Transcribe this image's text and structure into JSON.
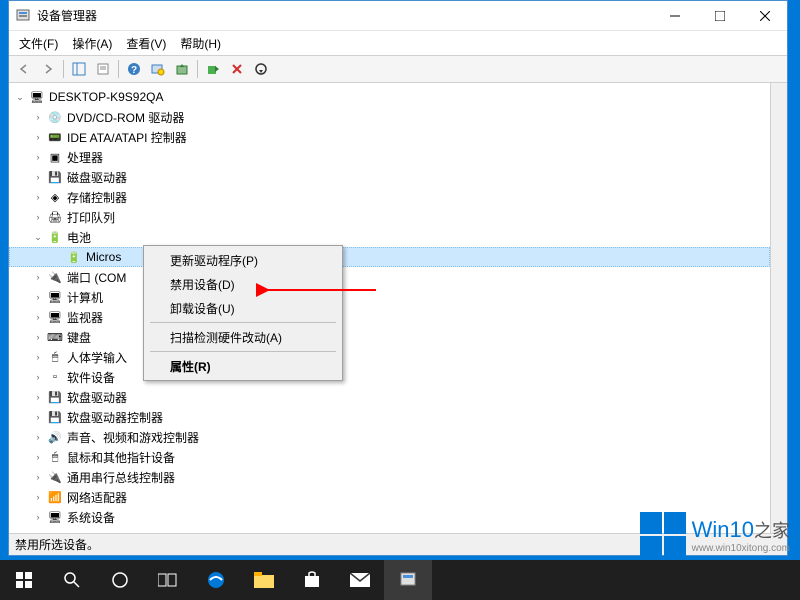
{
  "window": {
    "title": "设备管理器"
  },
  "menubar": {
    "file": "文件(F)",
    "action": "操作(A)",
    "view": "查看(V)",
    "help": "帮助(H)"
  },
  "tree": {
    "root": "DESKTOP-K9S92QA",
    "items": [
      {
        "label": "DVD/CD-ROM 驱动器",
        "icon": "💿"
      },
      {
        "label": "IDE ATA/ATAPI 控制器",
        "icon": "📟"
      },
      {
        "label": "处理器",
        "icon": "▣"
      },
      {
        "label": "磁盘驱动器",
        "icon": "💾"
      },
      {
        "label": "存储控制器",
        "icon": "◈"
      },
      {
        "label": "打印队列",
        "icon": "🖨"
      },
      {
        "label": "电池",
        "icon": "🔋",
        "expanded": true,
        "children": [
          {
            "label": "Micros",
            "icon": "🔋",
            "selected": true
          }
        ]
      },
      {
        "label": "端口 (COM",
        "icon": "🔌"
      },
      {
        "label": "计算机",
        "icon": "🖥"
      },
      {
        "label": "监视器",
        "icon": "🖥"
      },
      {
        "label": "键盘",
        "icon": "⌨"
      },
      {
        "label": "人体学输入",
        "icon": "🖱"
      },
      {
        "label": "软件设备",
        "icon": "▫"
      },
      {
        "label": "软盘驱动器",
        "icon": "💾"
      },
      {
        "label": "软盘驱动器控制器",
        "icon": "💾"
      },
      {
        "label": "声音、视频和游戏控制器",
        "icon": "🔊"
      },
      {
        "label": "鼠标和其他指针设备",
        "icon": "🖱"
      },
      {
        "label": "通用串行总线控制器",
        "icon": "🔌"
      },
      {
        "label": "网络适配器",
        "icon": "📶"
      },
      {
        "label": "系统设备",
        "icon": "🖥"
      }
    ]
  },
  "contextMenu": {
    "updateDriver": "更新驱动程序(P)",
    "disableDevice": "禁用设备(D)",
    "uninstallDevice": "卸载设备(U)",
    "scanHardware": "扫描检测硬件改动(A)",
    "properties": "属性(R)"
  },
  "statusbar": {
    "text": "禁用所选设备。"
  },
  "watermark": {
    "brand": "Win10",
    "suffix": "之家",
    "url": "www.win10xitong.com"
  }
}
